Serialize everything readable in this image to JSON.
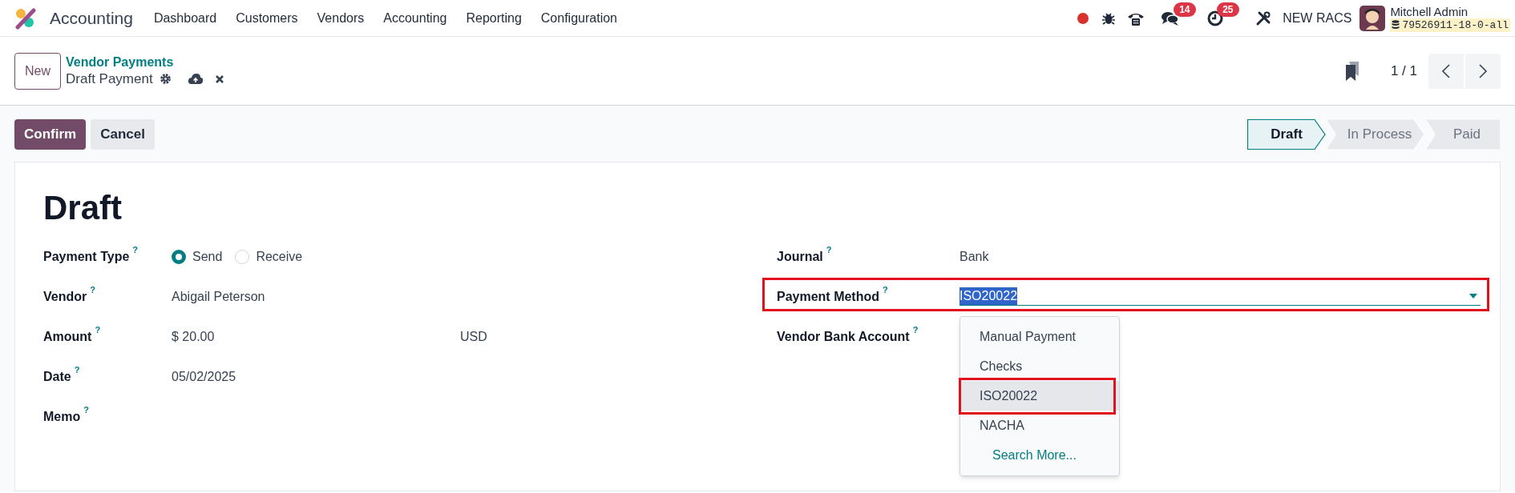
{
  "navbar": {
    "app_name": "Accounting",
    "menu": [
      "Dashboard",
      "Customers",
      "Vendors",
      "Accounting",
      "Reporting",
      "Configuration"
    ],
    "messages_badge": "14",
    "activities_badge": "25",
    "company": "NEW RACS",
    "user_name": "Mitchell Admin",
    "database": "79526911-18-0-all"
  },
  "control_panel": {
    "new_button": "New",
    "breadcrumb": "Vendor Payments",
    "record": "Draft Payment",
    "pager": "1 / 1"
  },
  "actions": [
    {
      "label": "Confirm",
      "kind": "primary"
    },
    {
      "label": "Cancel",
      "kind": "secondary"
    }
  ],
  "statusbar": [
    {
      "label": "Draft",
      "selected": true
    },
    {
      "label": "In Process",
      "selected": false
    },
    {
      "label": "Paid",
      "selected": false
    }
  ],
  "form": {
    "title": "Draft",
    "left_fields": [
      {
        "label": "Payment Type",
        "help": "?",
        "kind": "radio",
        "options": [
          {
            "label": "Send",
            "selected": true
          },
          {
            "label": "Receive",
            "selected": false
          }
        ]
      },
      {
        "label": "Vendor",
        "help": "?",
        "kind": "text",
        "value": "Abigail Peterson"
      },
      {
        "label": "Amount",
        "help": "?",
        "kind": "amount",
        "value": "$ 20.00",
        "currency": "USD"
      },
      {
        "label": "Date",
        "help": "?",
        "kind": "text",
        "value": "05/02/2025"
      },
      {
        "label": "Memo",
        "help": "?",
        "kind": "empty"
      }
    ],
    "right_fields": [
      {
        "label": "Journal",
        "help": "?",
        "kind": "text",
        "value": "Bank"
      },
      {
        "label": "Payment Method",
        "help": "?",
        "kind": "select",
        "value": "ISO20022",
        "highlighted": true,
        "options": [
          {
            "label": "Manual Payment",
            "selected": false,
            "highlighted": false
          },
          {
            "label": "Checks",
            "selected": false,
            "highlighted": false
          },
          {
            "label": "ISO20022",
            "selected": true,
            "highlighted": true
          },
          {
            "label": "NACHA",
            "selected": false,
            "highlighted": false
          }
        ],
        "search_more": "Search More..."
      },
      {
        "label": "Vendor Bank Account",
        "help": "?",
        "kind": "empty"
      }
    ]
  }
}
